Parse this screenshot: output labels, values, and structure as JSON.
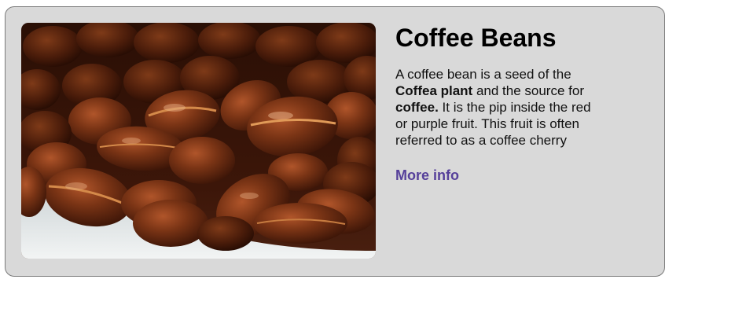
{
  "card": {
    "image": {
      "alt": "Coffee Beans",
      "icon": "coffee-beans-photo"
    },
    "title": "Coffee Beans",
    "description": {
      "part1": "A coffee bean is a seed of the ",
      "bold1": "Coffea plant",
      "part2": " and the source for ",
      "bold2": "coffee.",
      "part3": " It is the pip inside the red or purple fruit. This fruit is often referred to as a coffee cherry"
    },
    "link_label": "More info"
  },
  "colors": {
    "card_bg": "#d9d9d9",
    "card_border": "#7a7a7a",
    "link": "#56409a"
  }
}
